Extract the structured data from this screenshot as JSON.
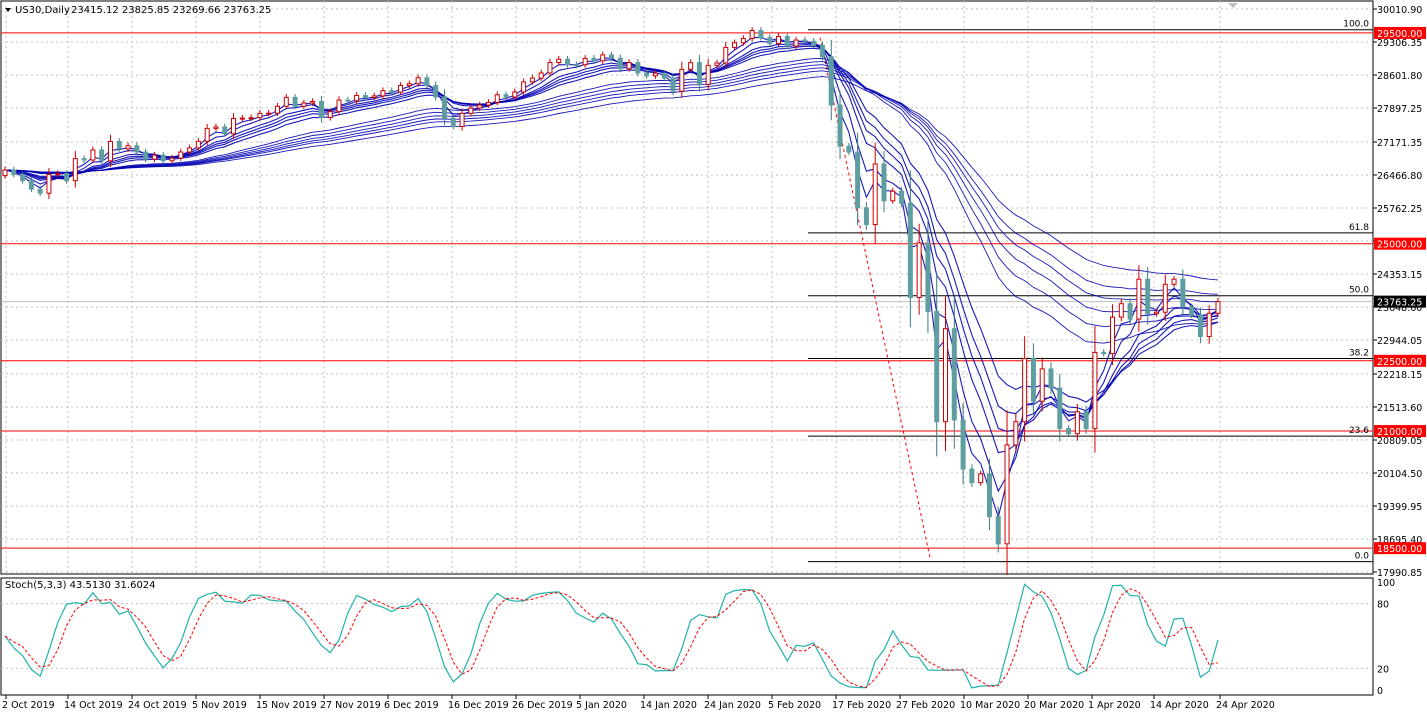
{
  "header": {
    "symbol_label": "US30,Daily",
    "ohlc": "23415.12 23825.85 23269.66 23763.25"
  },
  "stoch_header": "Stoch(5,3,3) 43.5130 31.6024",
  "colors": {
    "bull_candle": "#cc0000",
    "bear_candle": "#5f9ea0",
    "ma_line": "#0000b3",
    "level_line": "#ff0000",
    "fib_line": "#000000",
    "grid": "#c0c0c0",
    "stoch_main": "#20b2aa",
    "stoch_signal": "#ff0000"
  },
  "chart_data": {
    "type": "candlestick",
    "symbol": "US30",
    "timeframe": "Daily",
    "y_range": [
      17990.85,
      30010.9
    ],
    "price_ticks": [
      "30010.90",
      "29306.35",
      "28601.80",
      "27897.25",
      "27171.35",
      "26466.80",
      "25762.25",
      "25057.70",
      "24353.15",
      "23648.60",
      "22944.05",
      "22218.15",
      "21513.60",
      "20809.05",
      "20104.50",
      "19399.95",
      "18695.40",
      "17990.85"
    ],
    "date_labels": [
      "2 Oct 2019",
      "14 Oct 2019",
      "24 Oct 2019",
      "5 Nov 2019",
      "15 Nov 2019",
      "27 Nov 2019",
      "6 Dec 2019",
      "16 Dec 2019",
      "26 Dec 2019",
      "5 Jan 2020",
      "14 Jan 2020",
      "24 Jan 2020",
      "5 Feb 2020",
      "17 Feb 2020",
      "27 Feb 2020",
      "10 Mar 2020",
      "20 Mar 2020",
      "1 Apr 2020",
      "14 Apr 2020",
      "24 Apr 2020"
    ],
    "horizontal_levels": [
      {
        "label": "29500.00",
        "value": 29500
      },
      {
        "label": "25000.00",
        "value": 25000
      },
      {
        "label": "22500.00",
        "value": 22500
      },
      {
        "label": "21000.00",
        "value": 21000
      },
      {
        "label": "18500.00",
        "value": 18500
      }
    ],
    "current_price": {
      "label": "23763.25",
      "value": 23763.25
    },
    "fibonacci": {
      "high": 29568,
      "low": 18213,
      "levels": [
        {
          "label": "100.0",
          "value": 29568
        },
        {
          "label": "61.8",
          "value": 25230
        },
        {
          "label": "50.0",
          "value": 23890
        },
        {
          "label": "38.2",
          "value": 22550
        },
        {
          "label": "23.6",
          "value": 20893
        },
        {
          "label": "0.0",
          "value": 18213
        }
      ]
    },
    "trend_line": {
      "from": [
        29568,
        29400
      ],
      "to": [
        18213,
        18300
      ]
    },
    "closes": [
      26573,
      26480,
      26346,
      26164,
      26078,
      26478,
      26496,
      26346,
      26816,
      26787,
      27001,
      26770,
      27182,
      27025,
      27090,
      26958,
      26805,
      26891,
      26770,
      26827,
      26958,
      27046,
      27186,
      27462,
      27492,
      27347,
      27674,
      27681,
      27691,
      27783,
      27787,
      27934,
      28124,
      27934,
      28004,
      28036,
      27692,
      27821,
      28066,
      28051,
      28165,
      28121,
      28155,
      28267,
      28235,
      28377,
      28415,
      28543,
      28377,
      28135,
      27675,
      27502,
      27783,
      27896,
      27960,
      28016,
      28180,
      28132,
      28240,
      28454,
      28536,
      28645,
      28868,
      28939,
      28823,
      28822,
      28957,
      28903,
      29030,
      28960,
      28735,
      28868,
      28645,
      28584,
      28640,
      28535,
      28256,
      28723,
      28866,
      28399,
      28807,
      28859,
      29191,
      29290,
      29380,
      29551,
      29398,
      29276,
      29423,
      29219,
      29348,
      29320,
      29232,
      28992,
      27960,
      27081,
      26957,
      25766,
      25409,
      26703,
      25917,
      26121,
      25864,
      23851,
      25018,
      23553,
      21200,
      23185,
      21237,
      20188,
      19898,
      20087,
      19173,
      18592,
      20704,
      21200,
      22552,
      21636,
      22327,
      21917,
      21052,
      20943,
      21413,
      21053,
      22679,
      22654,
      23433,
      23719,
      23390,
      24242,
      23504,
      23537,
      24133,
      24242,
      23650,
      23475,
      23018,
      23515,
      23763
    ],
    "stoch_levels": [
      80,
      20
    ]
  }
}
